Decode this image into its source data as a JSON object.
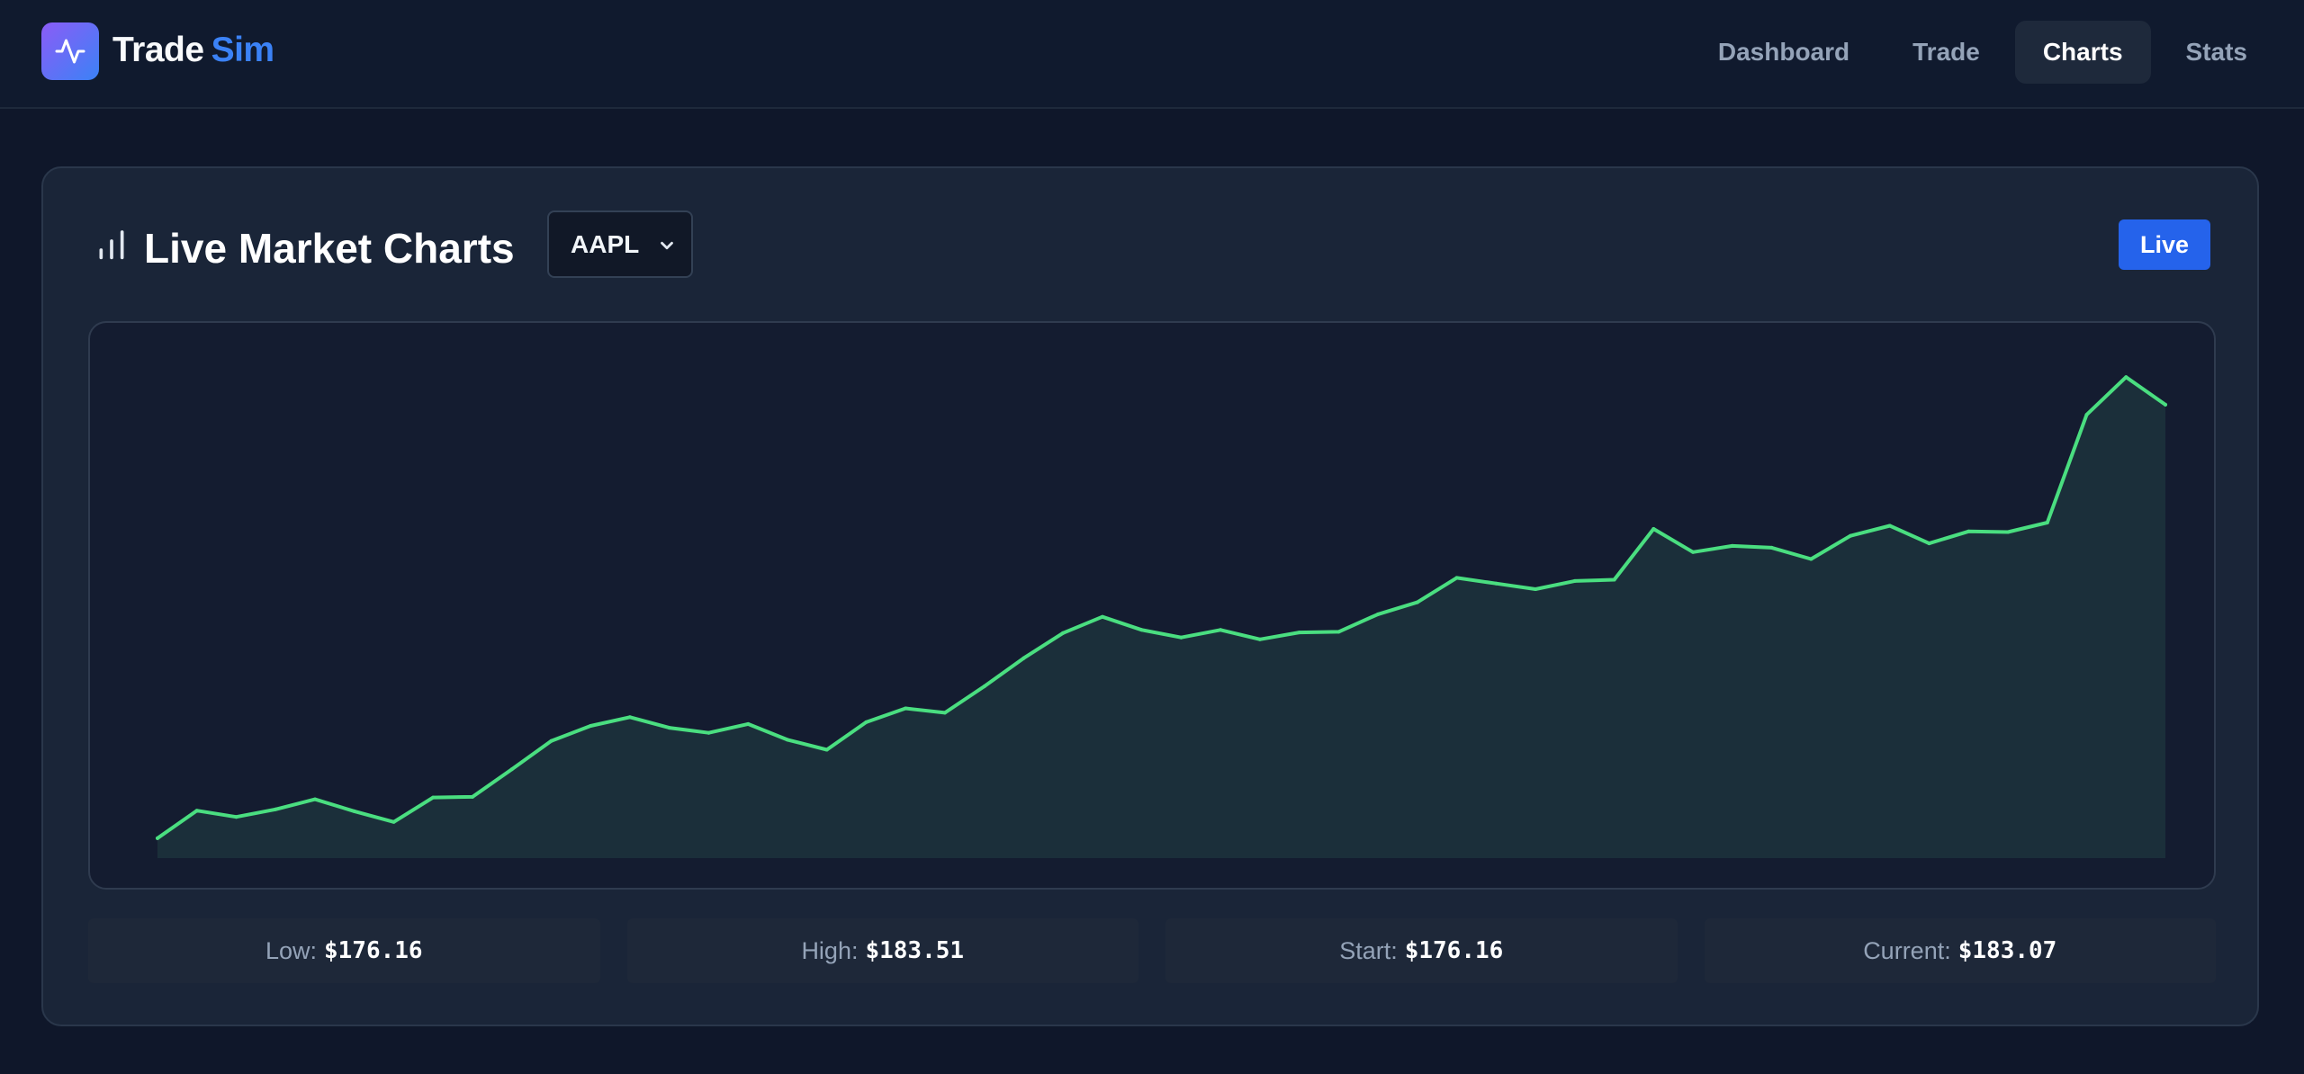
{
  "app": {
    "brand_first": "Trade",
    "brand_second": "Sim",
    "logo_icon": "activity-pulse-icon"
  },
  "nav": {
    "items": [
      {
        "label": "Dashboard",
        "active": false
      },
      {
        "label": "Trade",
        "active": false
      },
      {
        "label": "Charts",
        "active": true
      },
      {
        "label": "Stats",
        "active": false
      }
    ]
  },
  "card": {
    "title": "Live Market Charts",
    "title_icon": "bar-chart-icon",
    "symbol": "AAPL",
    "live_label": "Live"
  },
  "stats": {
    "low_label": "Low:",
    "low_value": "$176.16",
    "high_label": "High:",
    "high_value": "$183.51",
    "start_label": "Start:",
    "start_value": "$176.16",
    "current_label": "Current:",
    "current_value": "$183.07"
  },
  "colors": {
    "accent": "#3b82f6",
    "live_badge": "#2563eb",
    "line": "#4ade80",
    "area_fill": "#1b2f3a"
  },
  "chart_data": {
    "type": "area",
    "title": "",
    "xlabel": "",
    "ylabel": "",
    "grid": false,
    "ylim": [
      175.8,
      183.8
    ],
    "series": [
      {
        "values": [
          176.16,
          176.6,
          176.5,
          176.62,
          176.78,
          176.59,
          176.42,
          176.81,
          176.82,
          177.26,
          177.71,
          177.95,
          178.09,
          177.92,
          177.84,
          177.98,
          177.73,
          177.57,
          178.01,
          178.23,
          178.16,
          178.58,
          179.03,
          179.43,
          179.69,
          179.48,
          179.36,
          179.48,
          179.33,
          179.44,
          179.45,
          179.73,
          179.92,
          180.31,
          180.22,
          180.13,
          180.26,
          180.28,
          181.09,
          180.72,
          180.82,
          180.79,
          180.61,
          180.98,
          181.14,
          180.86,
          181.05,
          181.04,
          181.19,
          182.91,
          183.51,
          183.07
        ]
      }
    ]
  }
}
